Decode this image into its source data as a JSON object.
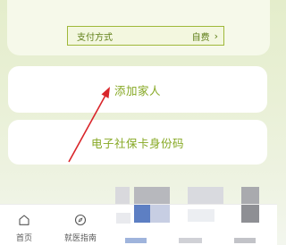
{
  "payment": {
    "label": "支付方式",
    "value": "自费",
    "chevron": "›"
  },
  "cards": [
    {
      "label": "添加家人"
    },
    {
      "label": "电子社保卡身份码"
    }
  ],
  "tabs": [
    {
      "label": "首页",
      "icon": "home-icon"
    },
    {
      "label": "就医指南",
      "icon": "compass-icon"
    }
  ],
  "colors": {
    "accent_green": "#86a823",
    "annotation_red": "#d9252a"
  }
}
